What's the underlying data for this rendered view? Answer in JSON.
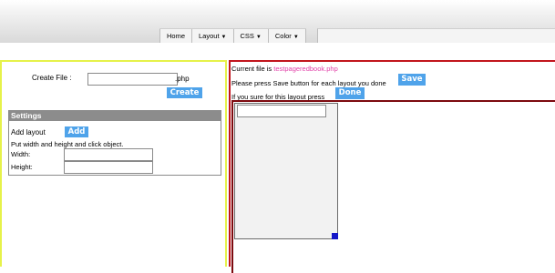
{
  "menu": {
    "items": [
      {
        "label": "Home",
        "dropdown": false
      },
      {
        "label": "Layout",
        "dropdown": true
      },
      {
        "label": "CSS",
        "dropdown": true
      },
      {
        "label": "Color",
        "dropdown": true
      }
    ]
  },
  "create_panel": {
    "label": "Create File :",
    "input_value": "",
    "extension": ".php",
    "button": "Create"
  },
  "settings": {
    "title": "Settings",
    "add_layout_label": "Add layout",
    "add_button": "Add",
    "hint": "Put width and height and click object.",
    "width_label": "Width:",
    "width_value": "",
    "height_label": "Height:",
    "height_value": ""
  },
  "status": {
    "current_file_prefix": "Current file is ",
    "current_file_name": "testpageredbook.php",
    "save_text": "Please press Save button for each layout you done",
    "save_button": "Save",
    "done_text": "If you sure for this layout press",
    "done_button": "Done"
  },
  "canvas": {
    "layout_input_value": ""
  },
  "colors": {
    "left_border": "#e6f24a",
    "right_border": "#c2161d",
    "button_blue": "#4fa3ea",
    "filename_pink": "#e23fa8",
    "resize_handle": "#1416c8"
  }
}
